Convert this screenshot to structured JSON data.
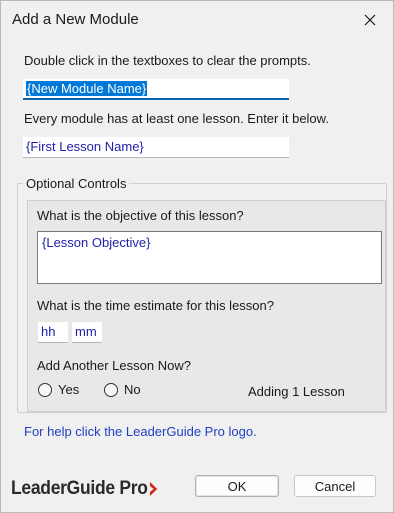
{
  "window": {
    "title": "Add a New Module"
  },
  "form": {
    "instructions": "Double click in the textboxes to clear the prompts.",
    "module_name_value": "{New Module Name}",
    "lesson_note": "Every module has at least one lesson. Enter it below.",
    "first_lesson_value": "{First Lesson Name}"
  },
  "optional": {
    "group_label": "Optional Controls",
    "objective_question": "What is the objective of this lesson?",
    "objective_value": "{Lesson Objective}",
    "time_question": "What is the time estimate for this lesson?",
    "hours_value": "hh",
    "minutes_value": "mm",
    "another_question": "Add Another Lesson Now?",
    "yes_label": "Yes",
    "no_label": "No",
    "adding_status": "Adding 1 Lesson"
  },
  "footer": {
    "help_text": "For help click the LeaderGuide Pro logo.",
    "logo_text": "LeaderGuide Pro",
    "logo_mark_color": "#d0271d",
    "ok_label": "OK",
    "cancel_label": "Cancel"
  }
}
